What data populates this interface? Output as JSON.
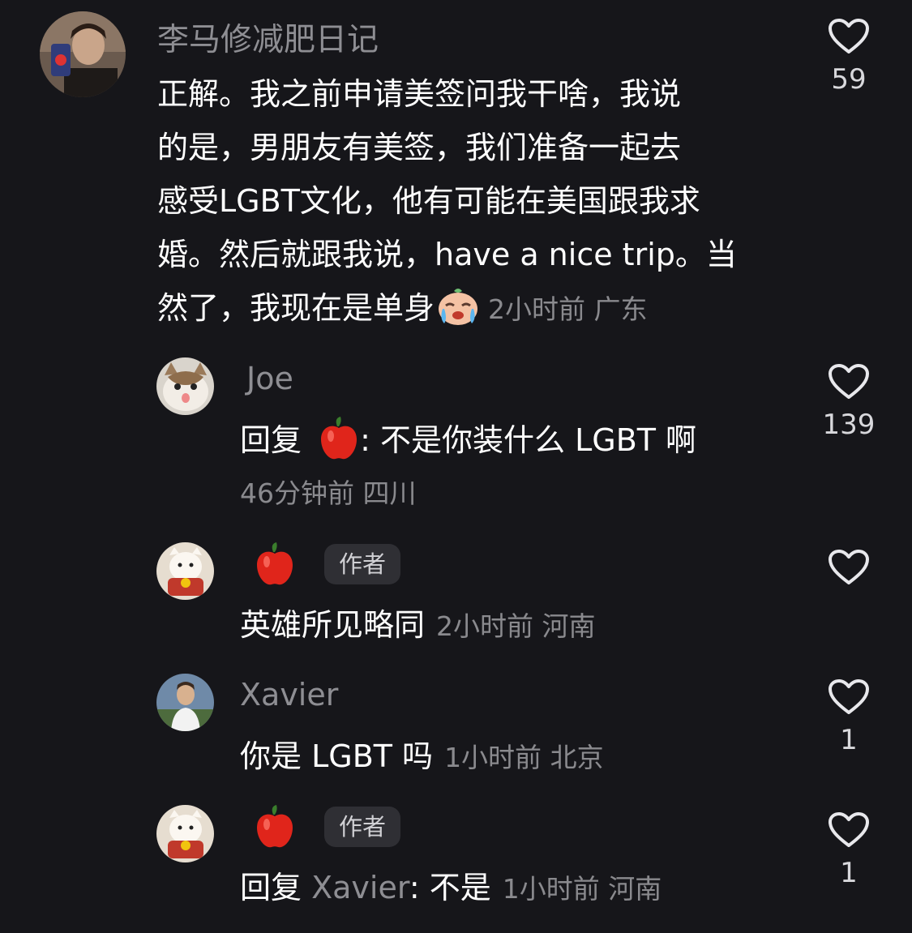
{
  "comments": [
    {
      "name": "李马修减肥日记",
      "lines": [
        "正解。我之前申请美签问我干啥，我说",
        "的是，男朋友有美签，我们准备一起去",
        "感受LGBT文化，他有可能在美国跟我求",
        "婚。然后就跟我说，have a nice trip。当",
        "然了，我现在是单身"
      ],
      "emoji": "crying-face",
      "time": "2小时前",
      "location": "广东",
      "likes": "59"
    },
    {
      "name": "Joe",
      "reply_prefix": "回复",
      "reply_target_icon": "apple",
      "text": ": 不是你装什么 LGBT 啊",
      "time": "46分钟前",
      "location": "四川",
      "likes": "139"
    },
    {
      "name_icon": "apple",
      "badge": "作者",
      "text": "英雄所见略同",
      "time": "2小时前",
      "location": "河南",
      "likes": ""
    },
    {
      "name": "Xavier",
      "text": "你是 LGBT 吗",
      "time": "1小时前",
      "location": "北京",
      "likes": "1"
    },
    {
      "name_icon": "apple",
      "badge": "作者",
      "reply_prefix": "回复",
      "reply_target": "Xavier",
      "text": ": 不是",
      "time": "1小时前",
      "location": "河南",
      "likes": "1"
    }
  ],
  "colors": {
    "background": "#16161a",
    "text": "#ffffff",
    "secondary": "#8e8e93",
    "badge_bg": "#2f2f34"
  }
}
